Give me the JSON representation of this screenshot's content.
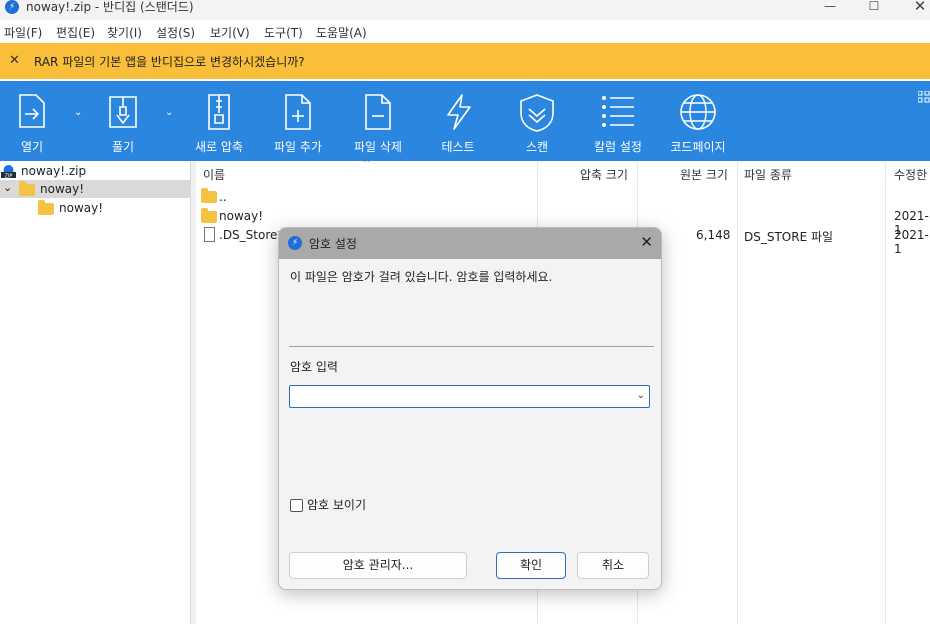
{
  "window": {
    "title": "noway!.zip - 반디집 (스탠더드)",
    "app_icon": "bandizip-icon",
    "controls": [
      "minimize-icon",
      "maximize-icon",
      "close-icon"
    ]
  },
  "menu": [
    "파일(F)",
    "편집(E)",
    "찾기(I)",
    "설정(S)",
    "보기(V)",
    "도구(T)",
    "도움말(A)"
  ],
  "notice": {
    "text": "RAR 파일의 기본 앱을 반디집으로 변경하시겠습니까?",
    "color": "#f9bf3b"
  },
  "toolbar": {
    "color": "#2a86df",
    "items": [
      {
        "label": "열기",
        "icon": "open-icon"
      },
      {
        "label": "풀기",
        "icon": "extract-icon"
      },
      {
        "label": "새로 압축",
        "icon": "new-archive-icon"
      },
      {
        "label": "파일 추가",
        "icon": "add-file-icon"
      },
      {
        "label": "파일 삭제",
        "icon": "delete-file-icon"
      },
      {
        "label": "테스트",
        "icon": "test-icon"
      },
      {
        "label": "스캔",
        "icon": "scan-icon"
      },
      {
        "label": "칼럼 설정",
        "icon": "column-settings-icon"
      },
      {
        "label": "코드페이지",
        "icon": "codepage-icon"
      }
    ]
  },
  "tree": {
    "items": [
      {
        "label": "noway!.zip",
        "icon": "zip-icon"
      },
      {
        "label": "noway!",
        "icon": "folder-icon",
        "selected": true
      },
      {
        "label": "noway!",
        "icon": "folder-icon"
      }
    ]
  },
  "filelist": {
    "columns": [
      "이름",
      "압축 크기",
      "원본 크기",
      "파일 종류",
      "수정한"
    ],
    "rows": [
      {
        "name": "..",
        "icon": "folder-icon",
        "packed": "",
        "size": "",
        "type": "",
        "modified": ""
      },
      {
        "name": "noway!",
        "icon": "folder-icon",
        "packed": "",
        "size": "",
        "type": "",
        "modified": "2021-1"
      },
      {
        "name": ".DS_Store*",
        "icon": "document-icon",
        "packed": "",
        "size": "6,148",
        "type": "DS_STORE 파일",
        "modified": "2021-1"
      }
    ]
  },
  "dialog": {
    "title": "암호 설정",
    "message": "이 파일은 암호가 걸려 있습니다. 암호를 입력하세요.",
    "input_label": "암호 입력",
    "input_value": "",
    "show_password_label": "암호 보이기",
    "show_password_checked": false,
    "buttons": {
      "manager": "암호 관리자...",
      "ok": "확인",
      "cancel": "취소"
    }
  }
}
